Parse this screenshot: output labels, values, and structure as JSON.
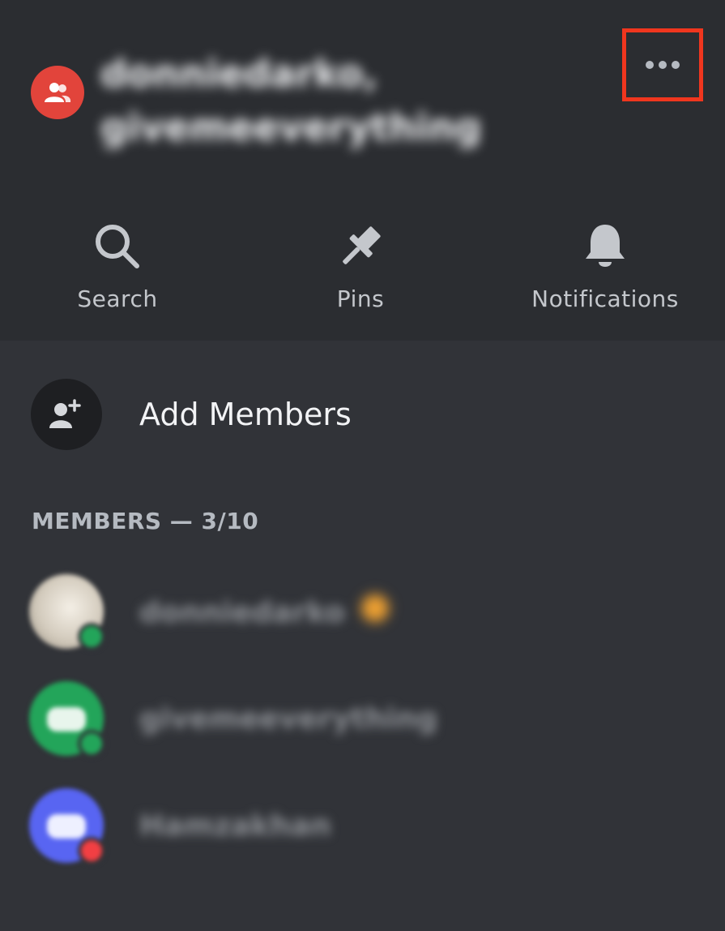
{
  "header": {
    "group_name_line1": "donniedarko,",
    "group_name_line2": "givemeeverything",
    "group_icon": "group-users-icon",
    "more_icon": "ellipsis-icon",
    "highlight_color": "#f0361e"
  },
  "actions": [
    {
      "label": "Search",
      "icon": "search-icon"
    },
    {
      "label": "Pins",
      "icon": "pin-icon"
    },
    {
      "label": "Notifications",
      "icon": "bell-icon"
    }
  ],
  "add_members": {
    "label": "Add Members",
    "icon": "add-user-icon"
  },
  "members_section": {
    "header": "MEMBERS — 3/10"
  },
  "members": [
    {
      "name": "donniedarko",
      "status_color": "#23a55a",
      "avatar_color": "#d8d2c6",
      "owner_badge": true
    },
    {
      "name": "givemeeverything",
      "status_color": "#23a55a",
      "avatar_color": "#23a55a",
      "owner_badge": false
    },
    {
      "name": "Hamzakhan",
      "status_color": "#f23f43",
      "avatar_color": "#5865f2",
      "owner_badge": false
    }
  ],
  "colors": {
    "header_bg": "#2b2d31",
    "body_bg": "#313338",
    "group_avatar": "#e2443b"
  }
}
